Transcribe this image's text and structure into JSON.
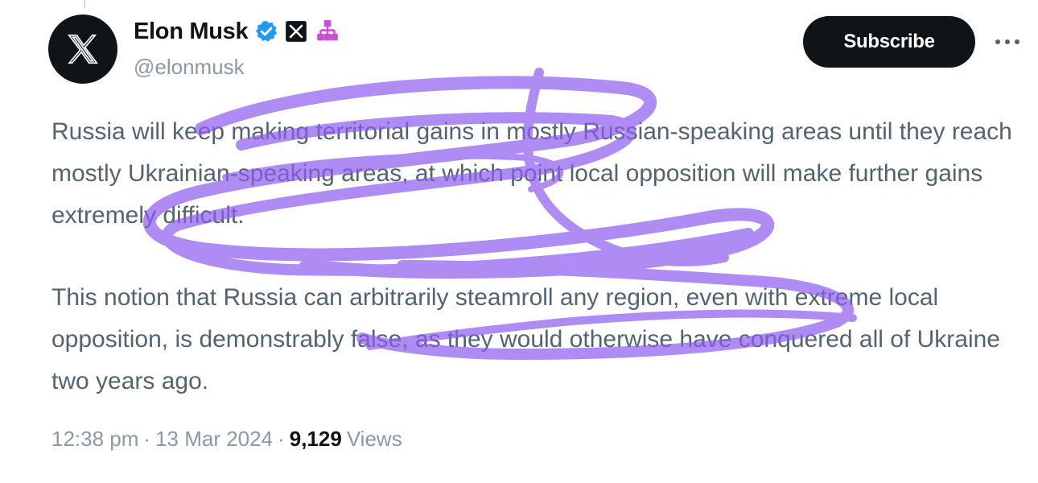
{
  "author": {
    "name": "Elon Musk",
    "handle": "@elonmusk",
    "avatar_icon": "x-logo-icon",
    "badges": [
      "verified-check-icon",
      "x-affiliate-icon",
      "sitemap-icon"
    ]
  },
  "actions": {
    "subscribe_label": "Subscribe",
    "more_icon": "more-horizontal-icon"
  },
  "tweet": {
    "paragraphs": [
      "Russia will keep making territorial gains in mostly Russian-speaking areas until they reach mostly Ukrainian-speaking areas, at which point local opposition will make further gains extremely difficult.",
      "This notion that Russia can arbitrarily steamroll any region, even with extreme local opposition, is demonstrably false, as they would otherwise have conquered all of Ukraine two years ago."
    ]
  },
  "meta": {
    "time": "12:38 pm",
    "date": "13 Mar 2024",
    "separator": "·",
    "views_count": "9,129",
    "views_label": "Views"
  },
  "colors": {
    "verified": "#1d9bf0",
    "affiliate_pink": "#c94fd6",
    "scribble": "#8e5cf0"
  }
}
